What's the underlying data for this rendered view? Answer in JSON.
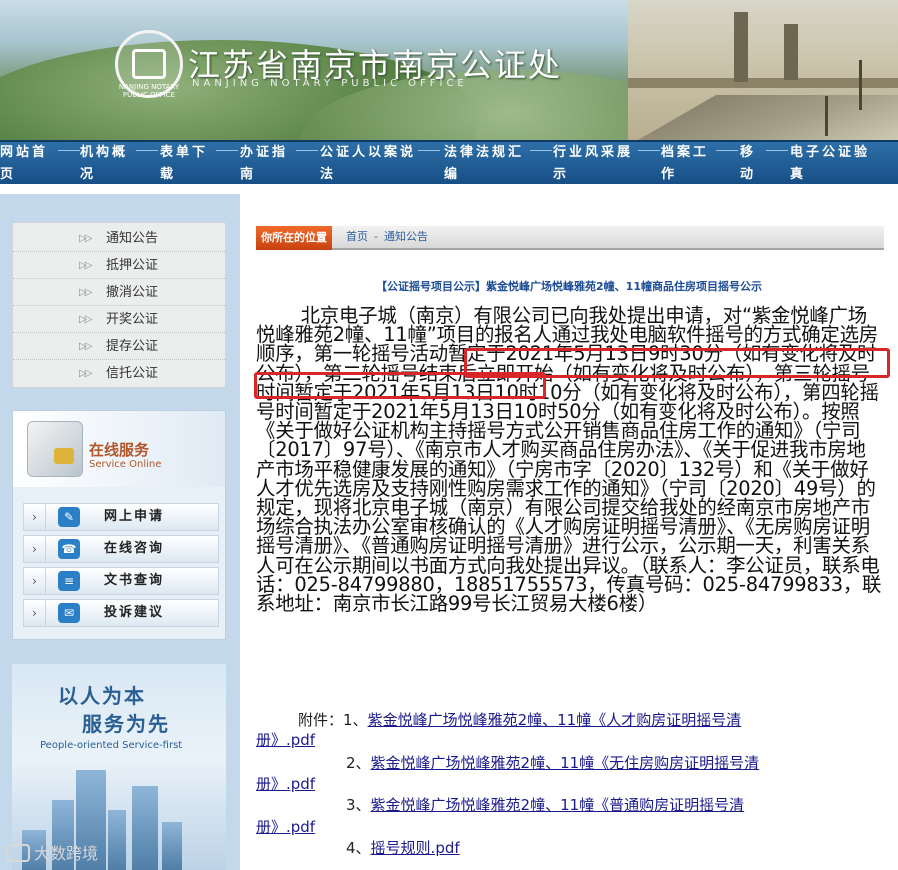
{
  "header": {
    "title": "江苏省南京市南京公证处",
    "subtitle": "NANJING NOTARY PUBLIC OFFICE",
    "seal_text": "NANJING NOTARY PUBLIC OFFICE"
  },
  "nav": {
    "items": [
      {
        "top": "网站首",
        "bottom": "页"
      },
      {
        "top": "机构概",
        "bottom": "况"
      },
      {
        "top": "表单下",
        "bottom": "载"
      },
      {
        "top": "办证指",
        "bottom": "南"
      },
      {
        "top": "公证人以案说",
        "bottom": "法"
      },
      {
        "top": "法律法规汇",
        "bottom": "编"
      },
      {
        "top": "行业风采展",
        "bottom": "示"
      },
      {
        "top": "档案工",
        "bottom": "作"
      },
      {
        "top": "移",
        "bottom": "动"
      },
      {
        "top": "电子公证验",
        "bottom": "真"
      }
    ]
  },
  "sidebar": {
    "menu": [
      {
        "arrow": "▷▷",
        "label": "通知公告"
      },
      {
        "arrow": "▷▷",
        "label": "抵押公证"
      },
      {
        "arrow": "▷▷",
        "label": "撤消公证"
      },
      {
        "arrow": "▷▷",
        "label": "开奖公证"
      },
      {
        "arrow": "▷▷",
        "label": "提存公证"
      },
      {
        "arrow": "▷▷",
        "label": "信托公证"
      }
    ],
    "service": {
      "title": "在线服务",
      "title_en": "Service Online",
      "items": [
        {
          "chev": "›",
          "icon": "✎",
          "label": "网上申请"
        },
        {
          "chev": "›",
          "icon": "☎",
          "label": "在线咨询"
        },
        {
          "chev": "›",
          "icon": "≡",
          "label": "文书查询"
        },
        {
          "chev": "›",
          "icon": "✉",
          "label": "投诉建议"
        }
      ]
    },
    "promo": {
      "line1": "以人为本",
      "line2": "服务为先",
      "line3": "People-oriented  Service-first"
    },
    "watermark": "大数跨境"
  },
  "location": {
    "tag": "你所在的位置",
    "home": "首页",
    "dash": "-",
    "current": "通知公告"
  },
  "article": {
    "title": "【公证摇号项目公示】紫金悦峰广场悦峰雅苑2幢、11幢商品住房项目摇号公示",
    "body": "北京电子城（南京）有限公司已向我处提出申请，对“紫金悦峰广场悦峰雅苑2幢、11幢”项目的报名人通过我处电脑软件摇号的方式确定选房顺序，第一轮摇号活动暂定于2021年5月13日9时30分（如有变化将及时公布），第二轮摇号结束后立即开始（如有变化将及时公布），第三轮摇号时间暂定于2021年5月13日10时10分（如有变化将及时公布），第四轮摇号时间暂定于2021年5月13日10时50分（如有变化将及时公布）。按照《关于做好公证机构主持摇号方式公开销售商品住房工作的通知》（宁司〔2017〕97号）、《南京市人才购买商品住房办法》、《关于促进我市房地产市场平稳健康发展的通知》（宁房市字〔2020〕132号）和《关于做好人才优先选房及支持刚性购房需求工作的通知》（宁司〔2020〕49号）的规定，现将北京电子城（南京）有限公司提交给我处的经南京市房地产市场综合执法办公室审核确认的《人才购房证明摇号清册》、《无房购房证明摇号清册》、《普通购房证明摇号清册》进行公示，公示期一天，利害关系人可在公示期间以书面方式向我处提出异议。（联系人：李公证员，联系电话：025-84799880，18851755573，传真号码：025-84799833，联系地址：南京市长江路99号长江贸易大楼6楼）",
    "attachments_prefix": "附件：",
    "attachments": [
      {
        "num": "1、",
        "text_a": "紫金悦峰广场悦峰雅苑2幢、11幢《人才购房证明摇号清",
        "text_b": "册》.pdf"
      },
      {
        "num": "2、",
        "text_a": "紫金悦峰广场悦峰雅苑2幢、11幢《无住房购房证明摇号清",
        "text_b": "册》.pdf"
      },
      {
        "num": "3、",
        "text_a": "紫金悦峰广场悦峰雅苑2幢、11幢《普通购房证明摇号清",
        "text_b": "册》.pdf"
      },
      {
        "num": "4、",
        "text_a": "摇号规则.pdf",
        "text_b": ""
      }
    ]
  },
  "colors": {
    "nav_bg": "#174f86",
    "sidebar_bg": "#c3d8ea",
    "location_tag": "#e05a1e",
    "title_blue": "#1c4d96",
    "highlight_red": "#d8262b",
    "link": "#1a1a8c"
  }
}
